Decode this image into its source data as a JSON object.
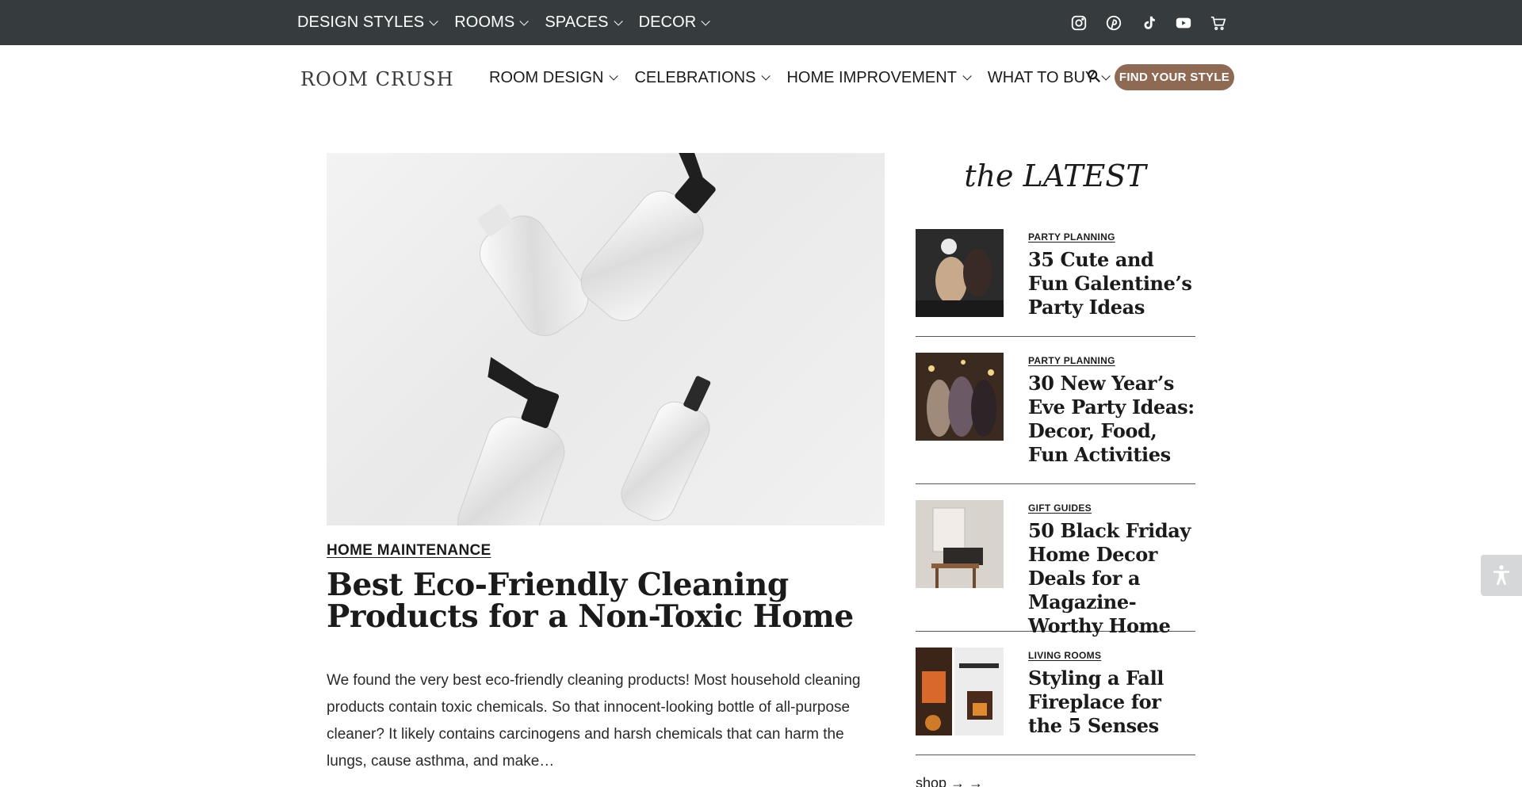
{
  "topbar": {
    "nav": [
      {
        "label": "DESIGN STYLES"
      },
      {
        "label": "ROOMS"
      },
      {
        "label": "SPACES"
      },
      {
        "label": "DECOR"
      }
    ],
    "social_icons": [
      "instagram-icon",
      "pinterest-icon",
      "tiktok-icon",
      "youtube-icon",
      "cart-icon"
    ]
  },
  "header": {
    "logo": "ROOM CRUSH",
    "nav": [
      {
        "label": "ROOM DESIGN"
      },
      {
        "label": "CELEBRATIONS"
      },
      {
        "label": "HOME IMPROVEMENT"
      },
      {
        "label": "WHAT TO BUY"
      }
    ],
    "cta": "FIND YOUR STYLE"
  },
  "post": {
    "category": "HOME MAINTENANCE",
    "title": "Best Eco-Friendly Cleaning Products for a Non-Toxic Home",
    "excerpt": "We found the very best eco-friendly cleaning products! Most household cleaning products contain toxic chemicals. So that innocent-looking bottle of all-purpose cleaner? It likely contains carcinogens and harsh chemicals that can harm the lungs, cause asthma, and make…"
  },
  "sidebar": {
    "heading": "the LATEST",
    "items": [
      {
        "category": "PARTY PLANNING",
        "title": "35 Cute and Fun Galentine’s Party Ideas"
      },
      {
        "category": "PARTY PLANNING",
        "title": "30 New Year’s Eve Party Ideas: Decor, Food, Fun Activities"
      },
      {
        "category": "GIFT GUIDES",
        "title": "50 Black Friday Home Decor Deals for a Magazine-Worthy Home"
      },
      {
        "category": "LIVING ROOMS",
        "title": "Styling a Fall Fireplace for the 5 Senses"
      }
    ],
    "shop_link": "shop → →"
  },
  "colors": {
    "topbar_bg": "#363c3d",
    "cta_bg": "#8e6a55",
    "text": "#1b1b1b"
  }
}
